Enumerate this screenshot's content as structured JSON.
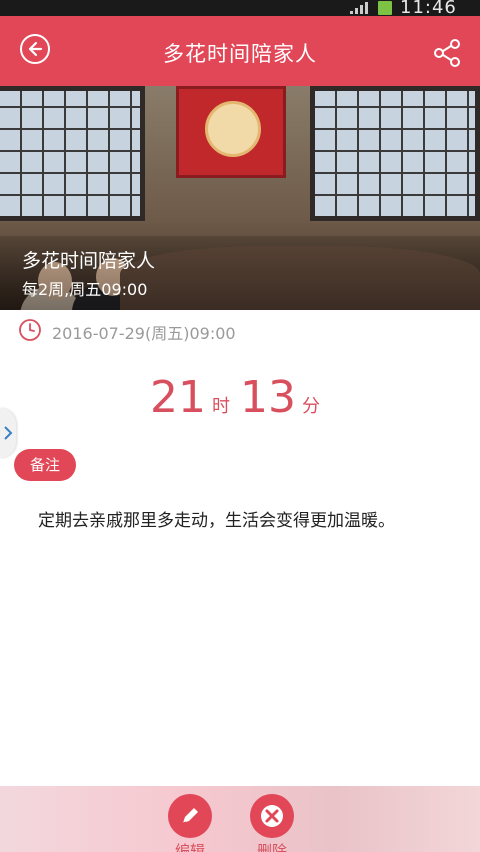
{
  "status_bar": {
    "time": "11:46"
  },
  "header": {
    "title": "多花时间陪家人"
  },
  "hero": {
    "title": "多花时间陪家人",
    "subtitle": "每2周,周五09:00"
  },
  "event": {
    "datetime": "2016-07-29(周五)09:00"
  },
  "countdown": {
    "hours": "21",
    "hours_unit": "时",
    "minutes": "13",
    "minutes_unit": "分"
  },
  "note": {
    "label": "备注",
    "text": "定期去亲戚那里多走动，生活会变得更加温暖。"
  },
  "actions": {
    "edit_label": "编辑",
    "delete_label": "删除"
  },
  "colors": {
    "accent": "#e14757",
    "countdown": "#d8505e",
    "muted_text": "#9a9a9a"
  },
  "icons": [
    "back-arrow-icon",
    "share-icon",
    "clock-icon",
    "chevron-right-icon",
    "pencil-icon",
    "close-x-icon"
  ]
}
